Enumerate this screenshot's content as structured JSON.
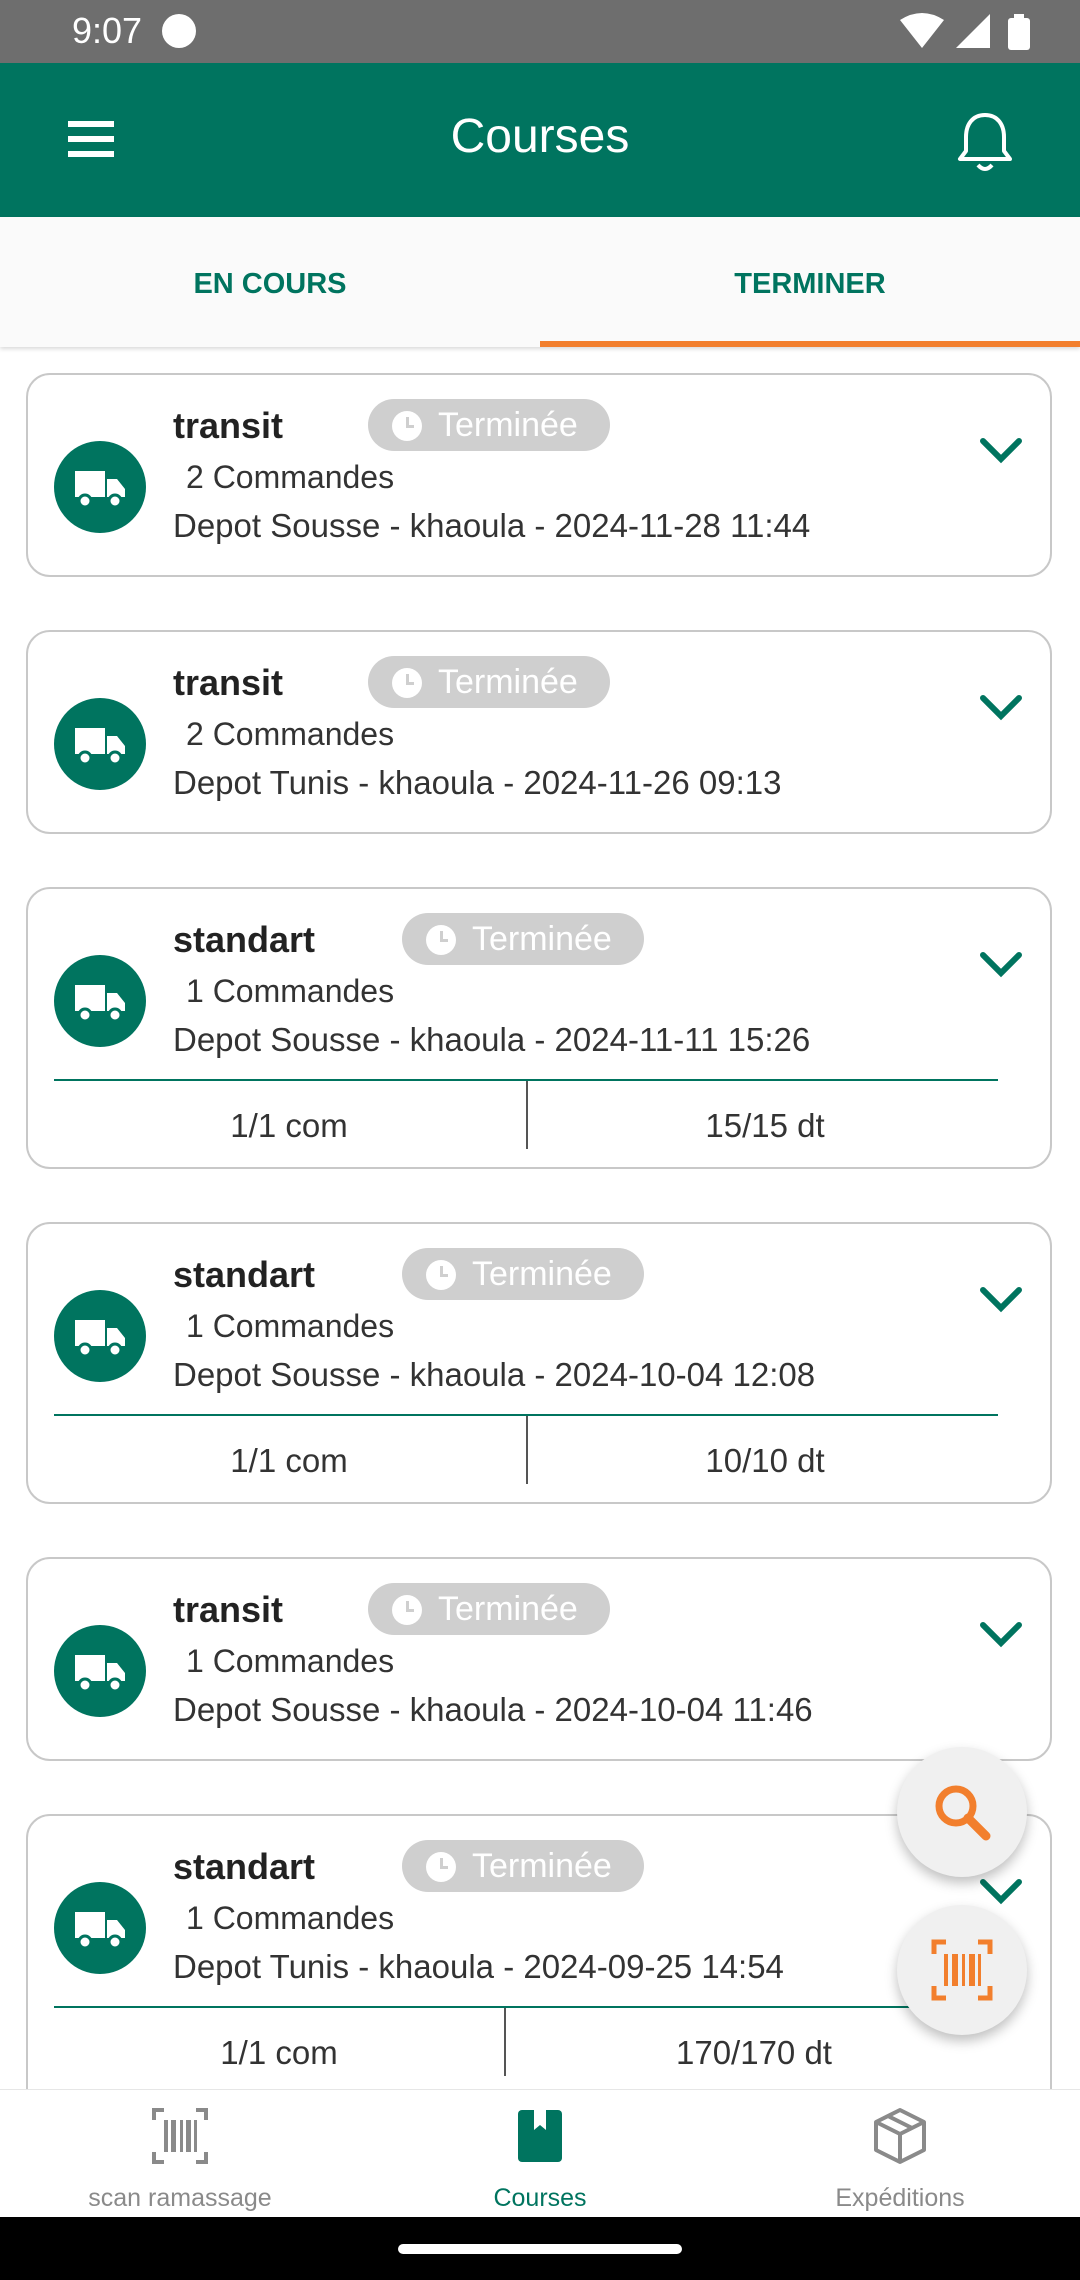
{
  "status_bar": {
    "time": "9:07"
  },
  "app_bar": {
    "title": "Courses",
    "menu_icon": "menu-icon",
    "notification_icon": "bell-icon"
  },
  "tabs": [
    {
      "label": "EN COURS"
    },
    {
      "label": "TERMINER",
      "active": true
    }
  ],
  "courses": [
    {
      "type": "transit",
      "status": "Terminée",
      "orders": "2 Commandes",
      "info": "Depot Sousse - khaoula - 2024-11-28 11:44"
    },
    {
      "type": "transit",
      "status": "Terminée",
      "orders": "2 Commandes",
      "info": "Depot Tunis - khaoula - 2024-11-26 09:13"
    },
    {
      "type": "standart",
      "status": "Terminée",
      "orders": "1 Commandes",
      "info": "Depot Sousse - khaoula - 2024-11-11 15:26",
      "coms": "1/1 com",
      "amount": "15/15 dt"
    },
    {
      "type": "standart",
      "status": "Terminée",
      "orders": "1 Commandes",
      "info": "Depot Sousse - khaoula - 2024-10-04 12:08",
      "coms": "1/1 com",
      "amount": "10/10 dt"
    },
    {
      "type": "transit",
      "status": "Terminée",
      "orders": "1 Commandes",
      "info": "Depot Sousse - khaoula - 2024-10-04 11:46"
    },
    {
      "type": "standart",
      "status": "Terminée",
      "orders": "1 Commandes",
      "info": "Depot Tunis - khaoula - 2024-09-25 14:54",
      "coms": "1/1 com",
      "amount": "170/170 dt"
    }
  ],
  "fabs": {
    "search_icon": "search-icon",
    "scan_icon": "barcode-scan-icon"
  },
  "bottom_nav": [
    {
      "label": "scan ramassage",
      "icon": "barcode-icon"
    },
    {
      "label": "Courses",
      "icon": "bookmark-book-icon",
      "active": true
    },
    {
      "label": "Expéditions",
      "icon": "box-icon"
    }
  ],
  "colors": {
    "primary": "#00745f",
    "accent": "#f27f2d",
    "badge": "#cfcfcf"
  }
}
